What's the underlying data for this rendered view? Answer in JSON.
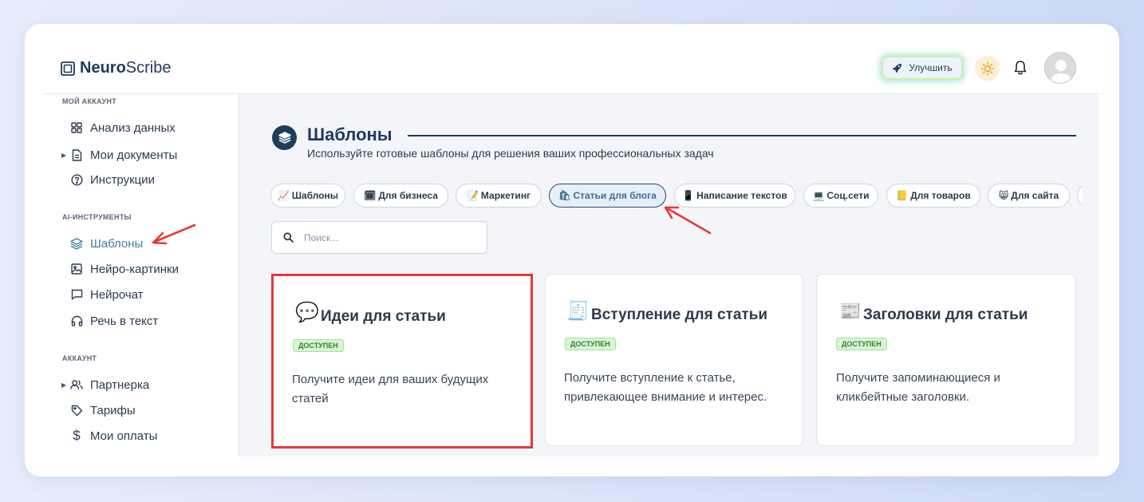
{
  "app": {
    "brand_bold": "Neuro",
    "brand_rest": "Scribe"
  },
  "header": {
    "upgrade_label": "Улучшить"
  },
  "sidebar": {
    "sections": [
      {
        "title": "МОЙ АККАУНТ"
      },
      {
        "title": "AI-ИНСТРУМЕНТЫ"
      },
      {
        "title": "АККАУНТ"
      }
    ],
    "items": [
      {
        "label": "Анализ данных",
        "icon": "grid-icon"
      },
      {
        "label": "Мои документы",
        "icon": "document-icon"
      },
      {
        "label": "Инструкции",
        "icon": "question-icon"
      },
      {
        "label": "Шаблоны",
        "icon": "layers-icon",
        "active": true
      },
      {
        "label": "Нейро-картинки",
        "icon": "image-icon"
      },
      {
        "label": "Нейрочат",
        "icon": "chat-icon"
      },
      {
        "label": "Речь в текст",
        "icon": "headphones-icon"
      },
      {
        "label": "Партнерка",
        "icon": "users-icon"
      },
      {
        "label": "Тарифы",
        "icon": "tag-icon"
      },
      {
        "label": "Мои оплаты",
        "icon": "dollar-icon"
      }
    ]
  },
  "main": {
    "title": "Шаблоны",
    "subtitle": "Используйте готовые шаблоны для решения ваших профессиональных задач",
    "chips": [
      {
        "emoji": "📈",
        "label": "Шаблоны"
      },
      {
        "emoji": "🗓",
        "label": "Для бизнеса"
      },
      {
        "emoji": "📝",
        "label": "Маркетинг"
      },
      {
        "emoji": "🛍",
        "label": "Статьи для блога",
        "active": true
      },
      {
        "emoji": "📱",
        "label": "Написание текстов"
      },
      {
        "emoji": "💻",
        "label": "Соц.сети"
      },
      {
        "emoji": "📒",
        "label": "Для товаров"
      },
      {
        "emoji": "😸",
        "label": "Для сайта"
      }
    ],
    "search_placeholder": "Поиск...",
    "cards": [
      {
        "emoji": "💬",
        "title": "Идеи для статьи",
        "badge": "ДОСТУПЕН",
        "description": "Получите идеи для ваших будущих статей"
      },
      {
        "emoji": "🧾",
        "title": "Вступление для статьи",
        "badge": "ДОСТУПЕН",
        "description": "Получите вступление к статье, привлекающее внимание и интерес."
      },
      {
        "emoji": "📰",
        "title": "Заголовки для статьи",
        "badge": "ДОСТУПЕН",
        "description": "Получите запоминающиеся и кликбейтные заголовки."
      }
    ]
  },
  "colors": {
    "accent": "#1f3a5c",
    "active_nav": "#3d7fa3",
    "highlight": "#e53935",
    "badge_bg": "#d8f5d4"
  }
}
